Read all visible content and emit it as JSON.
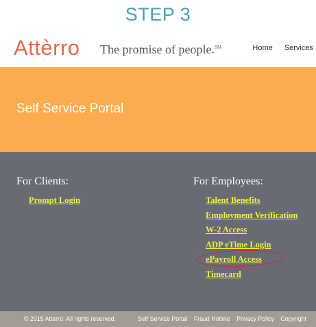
{
  "step_title": "STEP 3",
  "header": {
    "logo": "Attèrro",
    "tagline": "The promise of people.",
    "tagline_mark": "SM",
    "nav": [
      "Home",
      "Services"
    ]
  },
  "banner": {
    "title": "Self Service Portal"
  },
  "clients": {
    "heading": "For Clients:",
    "links": [
      "Prompt Login"
    ]
  },
  "employees": {
    "heading": "For Employees:",
    "links": [
      "Talent Benefits",
      "Employment Verification",
      "W-2 Access",
      "ADP eTime Login",
      "ePayroll Access",
      "Timecard"
    ]
  },
  "footer": {
    "copyright": "© 2015 Atterro. All rights reserved.",
    "links": [
      "Self Service Portal",
      "Fraud Hotline",
      "Privacy Policy",
      "Copyright"
    ]
  },
  "colors": {
    "accent_teal": "#4aa3b5",
    "logo_orange": "#e8664a",
    "banner": "#fbac4f",
    "panel": "#696b74",
    "link_yellow": "#eaf23a",
    "highlight_red": "#c8283a",
    "footer": "#a39b95"
  }
}
